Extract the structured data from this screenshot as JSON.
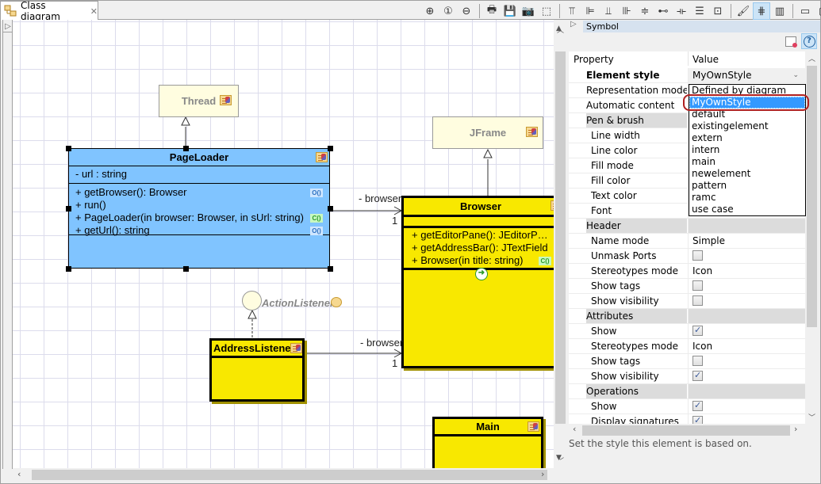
{
  "editor_tab": {
    "label": "Class diagram",
    "close_glyph": "✕"
  },
  "toolbar": {
    "buttons": [
      {
        "name": "zoom-in",
        "glyph": "⊕"
      },
      {
        "name": "zoom-reset",
        "glyph": "①"
      },
      {
        "name": "zoom-out",
        "glyph": "⊖"
      },
      {
        "name": "print",
        "glyph": "🖶"
      },
      {
        "name": "save",
        "glyph": "💾"
      },
      {
        "name": "screenshot",
        "glyph": "📷"
      },
      {
        "name": "select-region",
        "glyph": "⬚"
      },
      {
        "name": "align-top",
        "glyph": "⫪"
      },
      {
        "name": "align-left",
        "glyph": "⊫"
      },
      {
        "name": "align-bottom",
        "glyph": "⫫"
      },
      {
        "name": "align-right",
        "glyph": "⊪"
      },
      {
        "name": "center-horizontal",
        "glyph": "≑"
      },
      {
        "name": "center-vertical",
        "glyph": "⊷"
      },
      {
        "name": "distribute-horizontal",
        "glyph": "⟛"
      },
      {
        "name": "distribute-vertical",
        "glyph": "☰"
      },
      {
        "name": "same-size",
        "glyph": "⊡"
      },
      {
        "name": "format-painter",
        "glyph": "🖌"
      },
      {
        "name": "grid-toggle",
        "glyph": "⋕",
        "active": true
      },
      {
        "name": "layout",
        "glyph": "▥"
      },
      {
        "name": "minimize",
        "glyph": "▭"
      },
      {
        "name": "maximize",
        "glyph": "▢"
      }
    ]
  },
  "diagram": {
    "thread": {
      "name": "Thread"
    },
    "jframe": {
      "name": "JFrame"
    },
    "pageloader": {
      "name": "PageLoader",
      "attributes": [
        "- url : string"
      ],
      "operations": [
        {
          "text": "+ getBrowser(): Browser",
          "badge": "O()",
          "kind": "o"
        },
        {
          "text": "+ run()",
          "badge": "",
          "kind": ""
        },
        {
          "text": "+ PageLoader(in browser: Browser, in sUrl: string)",
          "badge": "C()",
          "kind": "c"
        },
        {
          "text": "+ getUrl(): string",
          "badge": "O()",
          "kind": "o"
        }
      ]
    },
    "browser": {
      "name": "Browser",
      "operations": [
        {
          "text": "+ getEditorPane(): JEditorP…",
          "badge": "",
          "kind": ""
        },
        {
          "text": "+ getAddressBar(): JTextField",
          "badge": "",
          "kind": ""
        },
        {
          "text": "+ Browser(in title: string)",
          "badge": "C()",
          "kind": "c"
        }
      ],
      "go_glyph": "➜"
    },
    "action_listener": {
      "name": "ActionListener"
    },
    "address_listener": {
      "name": "AddressListener"
    },
    "main": {
      "name": "Main"
    },
    "assoc1": {
      "role": "- browser",
      "multiplicity": "1"
    },
    "assoc2": {
      "role": "- browser",
      "multiplicity": "1"
    }
  },
  "properties": {
    "section_title": "Symbol",
    "columns": {
      "property": "Property",
      "value": "Value"
    },
    "rows": [
      {
        "key": "Element style",
        "value": "MyOwnStyle",
        "type": "combo",
        "bold": true
      },
      {
        "key": "Representation mode",
        "value": "",
        "type": "text"
      },
      {
        "key": "Automatic content",
        "value": "",
        "type": "text"
      },
      {
        "key": "Pen & brush",
        "type": "group"
      },
      {
        "key": "Line width",
        "value": "",
        "type": "text",
        "sub": true
      },
      {
        "key": "Line color",
        "value": "",
        "type": "text",
        "sub": true
      },
      {
        "key": "Fill mode",
        "value": "",
        "type": "text",
        "sub": true
      },
      {
        "key": "Fill color",
        "value": "",
        "type": "text",
        "sub": true
      },
      {
        "key": "Text color",
        "value": "",
        "type": "text",
        "sub": true
      },
      {
        "key": "Font",
        "value": "",
        "type": "text",
        "sub": true
      },
      {
        "key": "Header",
        "type": "group"
      },
      {
        "key": "Name mode",
        "value": "Simple",
        "type": "text",
        "sub": true
      },
      {
        "key": "Unmask Ports",
        "checked": false,
        "type": "check",
        "sub": true
      },
      {
        "key": "Stereotypes mode",
        "value": "Icon",
        "type": "text",
        "sub": true
      },
      {
        "key": "Show tags",
        "checked": false,
        "type": "check",
        "sub": true
      },
      {
        "key": "Show visibility",
        "checked": false,
        "type": "check",
        "sub": true
      },
      {
        "key": "Attributes",
        "type": "group"
      },
      {
        "key": "Show",
        "checked": true,
        "type": "check",
        "sub": true
      },
      {
        "key": "Stereotypes mode",
        "value": "Icon",
        "type": "text",
        "sub": true
      },
      {
        "key": "Show tags",
        "checked": false,
        "type": "check",
        "sub": true
      },
      {
        "key": "Show visibility",
        "checked": true,
        "type": "check",
        "sub": true
      },
      {
        "key": "Operations",
        "type": "group"
      },
      {
        "key": "Show",
        "checked": true,
        "type": "check",
        "sub": true
      },
      {
        "key": "Display signatures",
        "checked": true,
        "type": "check",
        "sub": true
      }
    ],
    "description": "Set the style this element is based on.",
    "dropdown": {
      "options": [
        "Defined by diagram",
        "MyOwnStyle",
        "default",
        "existingelement",
        "extern",
        "intern",
        "main",
        "newelement",
        "pattern",
        "ramc",
        "use case"
      ],
      "selected": "MyOwnStyle"
    }
  }
}
